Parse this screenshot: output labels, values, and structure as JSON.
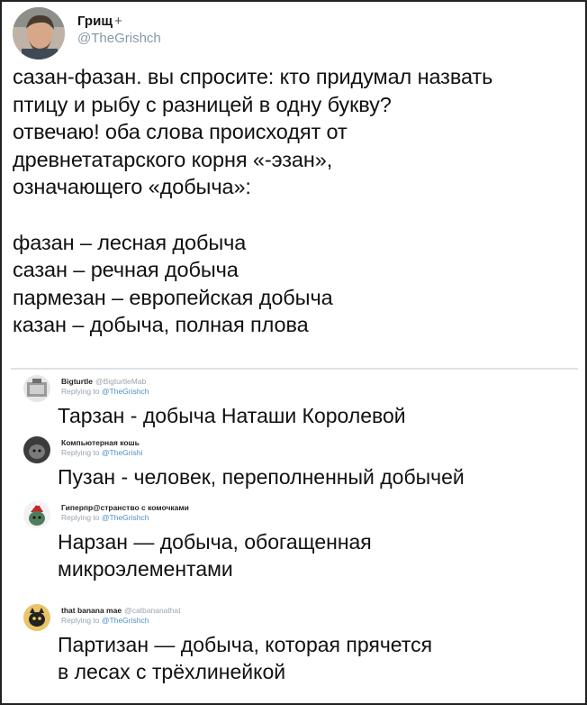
{
  "tweet": {
    "author_name": "Грищ",
    "author_suffix": "+",
    "author_handle": "@TheGrishch",
    "text_lines": [
      "сазан-фазан. вы спросите: кто придумал назвать",
      "птицу и рыбу с разницей в одну букву?",
      "отвечаю! оба слова происходят от",
      "древнетатарского корня «-эзан»,",
      "означающего «добыча»:"
    ],
    "list_lines": [
      "фазан – лесная добыча",
      "сазан – речная добыча",
      "пармезан – европейская добыча",
      "казан – добыча, полная плова"
    ]
  },
  "replies": [
    {
      "name": "Bigturtle",
      "handle": "@BigturtleMab",
      "replying_prefix": "Replying to",
      "replying_to": "@TheGrishch",
      "lines": [
        "Тарзан - добыча Наташи Королевой"
      ]
    },
    {
      "name": "Компьютерная кошь",
      "handle": "",
      "replying_prefix": "Replying to",
      "replying_to": "@TheGrishi",
      "lines": [
        "Пузан - человек, переполненный добычей"
      ]
    },
    {
      "name": "Гиперпр@странство с комочками",
      "handle": "",
      "replying_prefix": "Replying to",
      "replying_to": "@TheGrishch",
      "lines": [
        "Нарзан — добыча, обогащенная",
        "микроэлементами"
      ]
    },
    {
      "name": "that banana mae",
      "handle": "@catbananathat",
      "replying_prefix": "Replying to",
      "replying_to": "@TheGrishch",
      "lines": [
        "Партизан — добыча, которая прячется",
        "в лесах с трёхлинейкой"
      ]
    }
  ],
  "colors": {
    "handle_gray": "#8899a6",
    "link_blue": "#4a90c9",
    "divider": "#dfe3e6"
  }
}
